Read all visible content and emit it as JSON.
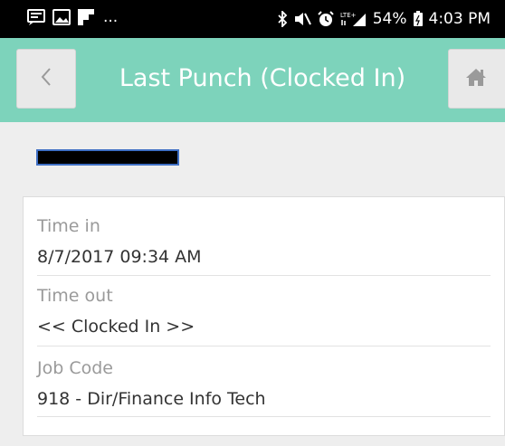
{
  "status_bar": {
    "icons_left": [
      "message-icon",
      "image-icon",
      "flipboard-icon"
    ],
    "overflow": "...",
    "icons_right": [
      "bluetooth-icon",
      "mute-icon",
      "alarm-icon",
      "lte-signal-icon"
    ],
    "battery_percent": "54%",
    "time": "4:03 PM"
  },
  "header": {
    "title": "Last Punch (Clocked In)",
    "background_color": "#7dd3bb"
  },
  "punch": {
    "fields": [
      {
        "label": "Time in",
        "value": "8/7/2017 09:34 AM"
      },
      {
        "label": "Time out",
        "value": "<< Clocked In >>"
      },
      {
        "label": "Job Code",
        "value": "918 - Dir/Finance Info Tech"
      }
    ]
  }
}
